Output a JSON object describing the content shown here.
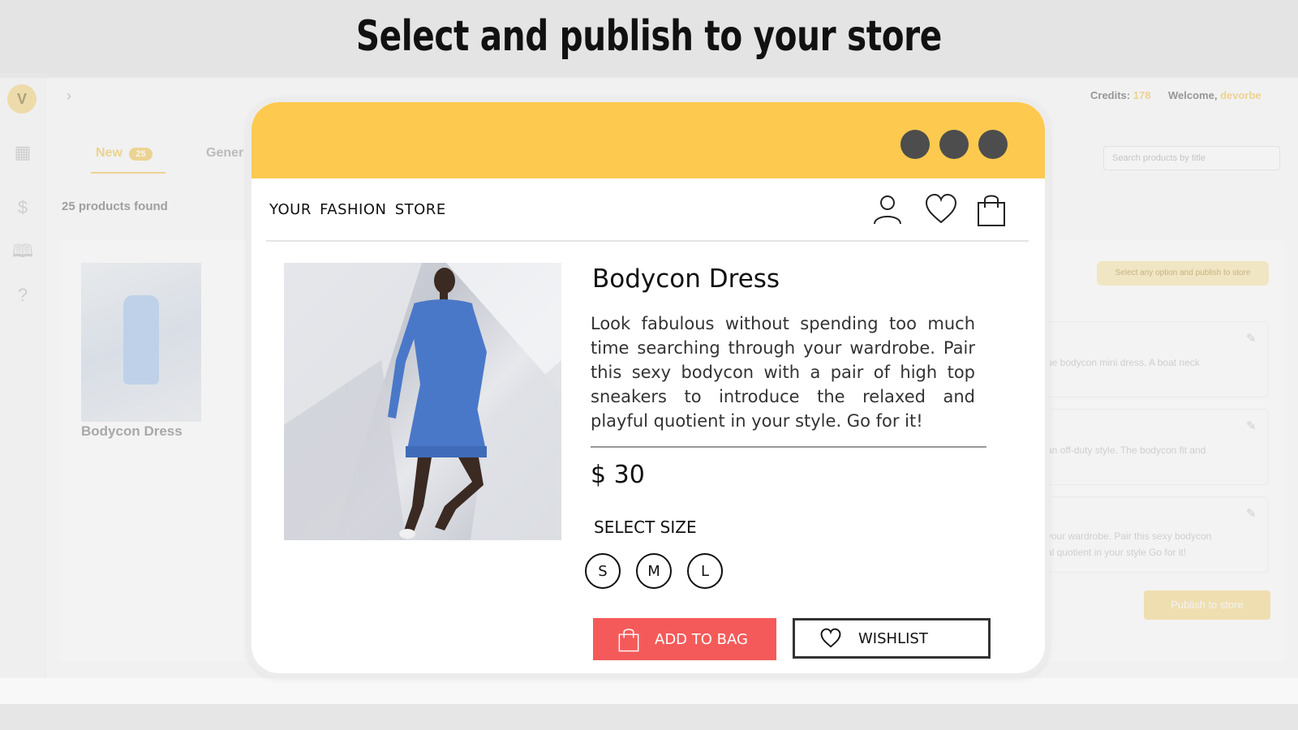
{
  "banner": {
    "title": "Select and publish to your store"
  },
  "app": {
    "logo_letter": "V",
    "credits_label": "Credits:",
    "credits_value": "178",
    "welcome_label": "Welcome,",
    "welcome_user": "devorbe",
    "tabs": [
      {
        "label": "New",
        "count": "25"
      },
      {
        "label": "Gener"
      }
    ],
    "products_found": "25 products found",
    "search_placeholder": "Search products by title",
    "list_item_title": "Bodycon Dress",
    "notice": "Select any option and publish to store",
    "option_snippets": [
      "ue bodycon mini dress. A boat neck",
      "an off-duty style. The bodycon fit and",
      "your wardrobe. Pair this sexy bodycon",
      "al quotient in your style   Go for it!"
    ],
    "publish_label": "Publish to store"
  },
  "store": {
    "name": "YOUR  FASHION  STORE",
    "product": {
      "title": "Bodycon Dress",
      "description": "Look fabulous without spending too much time searching through your wardrobe. Pair this sexy bodycon with a pair of high top sneakers to introduce the relaxed and playful quotient in your style.  Go for it!",
      "price": "$ 30",
      "size_label": "SELECT SIZE",
      "sizes": [
        "S",
        "M",
        "L"
      ],
      "add_to_bag_label": "ADD TO BAG",
      "wishlist_label": "WISHLIST"
    }
  },
  "icons": [
    "user-icon",
    "heart-icon",
    "shopping-bag-icon",
    "dashboard-icon",
    "dollar-icon",
    "book-icon",
    "help-icon",
    "edit-icon",
    "chevron-right-icon",
    "search-icon"
  ],
  "colors": {
    "header_yellow": "#fdc94f",
    "add_to_bag_red": "#f55a5a",
    "accent": "#f3c54e",
    "dot_gray": "#4d4d4d"
  }
}
